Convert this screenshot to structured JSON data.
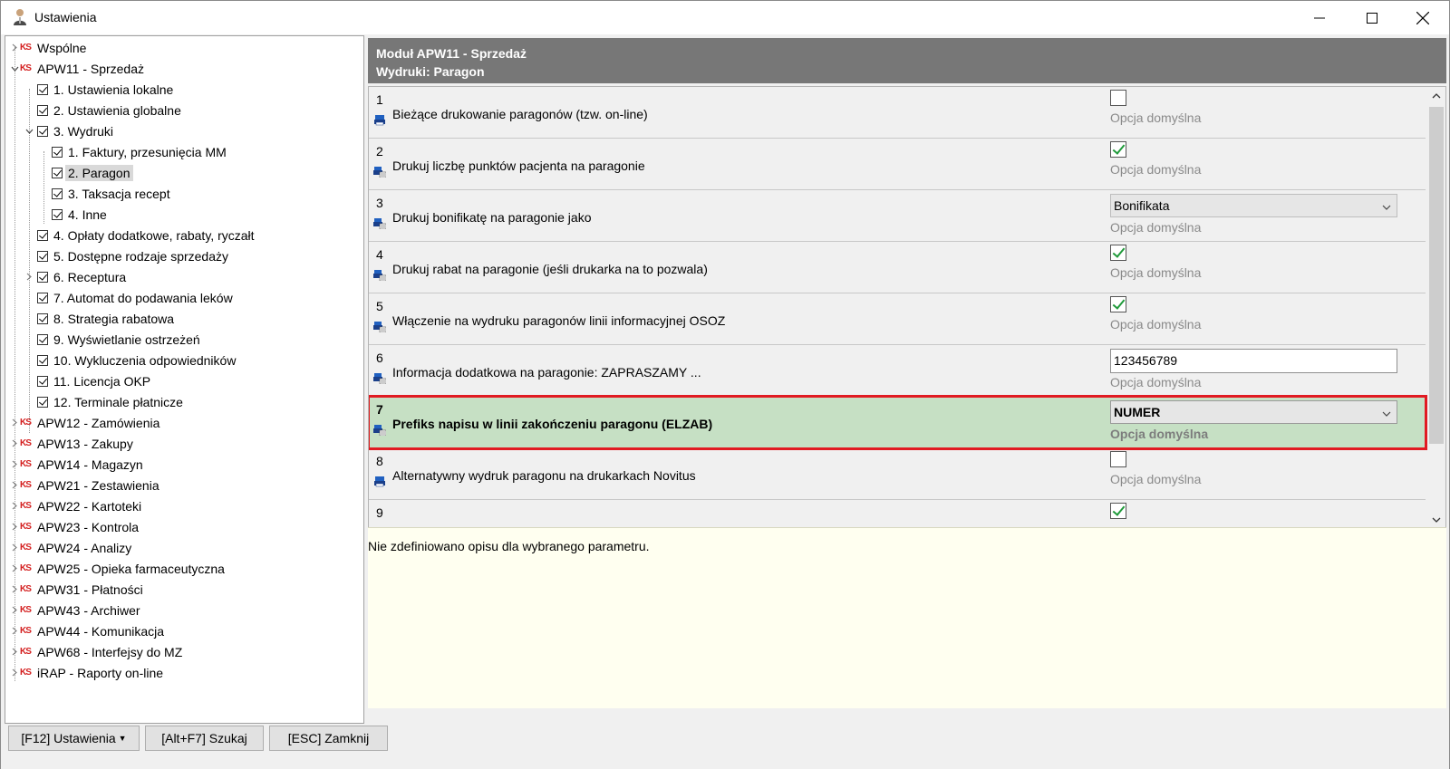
{
  "window": {
    "title": "Ustawienia",
    "controls": {
      "minimize": "minimize-icon",
      "maximize": "maximize-icon",
      "close": "close-icon"
    }
  },
  "tree": {
    "items": [
      {
        "label": "Wspólne",
        "level": 0,
        "icon": "ks-logo-icon",
        "expander": "collapsed"
      },
      {
        "label": "APW11 - Sprzedaż",
        "level": 0,
        "icon": "ks-logo-icon",
        "expander": "expanded"
      },
      {
        "label": "1. Ustawienia lokalne",
        "level": 1,
        "icon": "checkbox-icon",
        "expander": "none"
      },
      {
        "label": "2. Ustawienia globalne",
        "level": 1,
        "icon": "checkbox-icon",
        "expander": "none"
      },
      {
        "label": "3. Wydruki",
        "level": 1,
        "icon": "checkbox-icon",
        "expander": "expanded"
      },
      {
        "label": "1. Faktury, przesunięcia MM",
        "level": 2,
        "icon": "checkbox-icon",
        "expander": "none"
      },
      {
        "label": "2. Paragon",
        "level": 2,
        "icon": "checkbox-icon",
        "expander": "none",
        "selected": true
      },
      {
        "label": "3. Taksacja recept",
        "level": 2,
        "icon": "checkbox-icon",
        "expander": "none"
      },
      {
        "label": "4. Inne",
        "level": 2,
        "icon": "checkbox-icon",
        "expander": "none"
      },
      {
        "label": "4. Opłaty dodatkowe, rabaty, ryczałt",
        "level": 1,
        "icon": "checkbox-icon",
        "expander": "none"
      },
      {
        "label": "5. Dostępne rodzaje sprzedaży",
        "level": 1,
        "icon": "checkbox-icon",
        "expander": "none"
      },
      {
        "label": "6. Receptura",
        "level": 1,
        "icon": "checkbox-icon",
        "expander": "collapsed"
      },
      {
        "label": "7. Automat do podawania leków",
        "level": 1,
        "icon": "checkbox-icon",
        "expander": "none"
      },
      {
        "label": "8. Strategia rabatowa",
        "level": 1,
        "icon": "checkbox-icon",
        "expander": "none"
      },
      {
        "label": "9. Wyświetlanie ostrzeżeń",
        "level": 1,
        "icon": "checkbox-icon",
        "expander": "none"
      },
      {
        "label": "10. Wykluczenia odpowiedników",
        "level": 1,
        "icon": "checkbox-icon",
        "expander": "none"
      },
      {
        "label": "11. Licencja OKP",
        "level": 1,
        "icon": "checkbox-icon",
        "expander": "none"
      },
      {
        "label": "12. Terminale płatnicze",
        "level": 1,
        "icon": "checkbox-icon",
        "expander": "none"
      },
      {
        "label": "APW12 - Zamówienia",
        "level": 0,
        "icon": "ks-logo-icon",
        "expander": "collapsed"
      },
      {
        "label": "APW13 - Zakupy",
        "level": 0,
        "icon": "ks-logo-icon",
        "expander": "collapsed"
      },
      {
        "label": "APW14 - Magazyn",
        "level": 0,
        "icon": "ks-logo-icon",
        "expander": "collapsed"
      },
      {
        "label": "APW21 - Zestawienia",
        "level": 0,
        "icon": "ks-logo-icon",
        "expander": "collapsed"
      },
      {
        "label": "APW22 - Kartoteki",
        "level": 0,
        "icon": "ks-logo-icon",
        "expander": "collapsed"
      },
      {
        "label": "APW23 - Kontrola",
        "level": 0,
        "icon": "ks-logo-icon",
        "expander": "collapsed"
      },
      {
        "label": "APW24 - Analizy",
        "level": 0,
        "icon": "ks-logo-icon",
        "expander": "collapsed"
      },
      {
        "label": "APW25 - Opieka farmaceutyczna",
        "level": 0,
        "icon": "ks-logo-icon",
        "expander": "collapsed"
      },
      {
        "label": "APW31 - Płatności",
        "level": 0,
        "icon": "ks-logo-icon",
        "expander": "collapsed"
      },
      {
        "label": "APW43 - Archiwer",
        "level": 0,
        "icon": "ks-logo-icon",
        "expander": "collapsed"
      },
      {
        "label": "APW44 - Komunikacja",
        "level": 0,
        "icon": "ks-logo-icon",
        "expander": "collapsed"
      },
      {
        "label": "APW68 - Interfejsy do MZ",
        "level": 0,
        "icon": "ks-logo-icon",
        "expander": "collapsed"
      },
      {
        "label": "iRAP - Raporty on-line",
        "level": 0,
        "icon": "ks-logo-icon",
        "expander": "collapsed"
      }
    ]
  },
  "header": {
    "line1": "Moduł APW11 - Sprzedaż",
    "line2": "Wydruki: Paragon"
  },
  "params": [
    {
      "num": "1",
      "text": "Bieżące drukowanie paragonów (tzw. on-line)",
      "control": "checkbox",
      "checked": false,
      "default_label": "Opcja domyślna",
      "icon": "printer-icon"
    },
    {
      "num": "2",
      "text": "Drukuj liczbę punktów pacjenta na paragonie",
      "control": "checkbox",
      "checked": true,
      "default_label": "Opcja domyślna",
      "icon": "printer-settings-icon"
    },
    {
      "num": "3",
      "text": "Drukuj bonifikatę na paragonie jako",
      "control": "select",
      "value": "Bonifikata",
      "default_label": "Opcja domyślna",
      "icon": "printer-settings-icon"
    },
    {
      "num": "4",
      "text": "Drukuj rabat na paragonie (jeśli drukarka na to pozwala)",
      "control": "checkbox",
      "checked": true,
      "default_label": "Opcja domyślna",
      "icon": "printer-settings-icon"
    },
    {
      "num": "5",
      "text": "Włączenie na wydruku paragonów linii informacyjnej OSOZ",
      "control": "checkbox",
      "checked": true,
      "default_label": "Opcja domyślna",
      "icon": "printer-settings-icon"
    },
    {
      "num": "6",
      "text": "Informacja dodatkowa na paragonie: ZAPRASZAMY ...",
      "control": "input",
      "value": "123456789",
      "default_label": "Opcja domyślna",
      "icon": "printer-settings-icon"
    },
    {
      "num": "7",
      "text": "Prefiks napisu w linii zakończeniu paragonu (ELZAB)",
      "control": "select",
      "value": "NUMER",
      "default_label": "Opcja domyślna",
      "icon": "printer-settings-icon",
      "active": true
    },
    {
      "num": "8",
      "text": "Alternatywny wydruk paragonu na drukarkach Novitus",
      "control": "checkbox",
      "checked": false,
      "default_label": "Opcja domyślna",
      "icon": "printer-icon"
    },
    {
      "num": "9",
      "text": "",
      "control": "checkbox",
      "checked": true,
      "default_label": "",
      "icon": "printer-settings-icon"
    }
  ],
  "description": {
    "text": "Nie zdefiniowano opisu dla wybranego parametru."
  },
  "buttons": {
    "settings": "[F12] Ustawienia",
    "search": "[Alt+F7] Szukaj",
    "close": "[ESC] Zamknij"
  },
  "colors": {
    "header_bg": "#777777",
    "active_row_bg": "#c6e0c4",
    "highlight_border": "#e11b22",
    "description_bg": "#fffff0",
    "ks_logo": "#d42020",
    "check_green": "#1f9a3a"
  }
}
